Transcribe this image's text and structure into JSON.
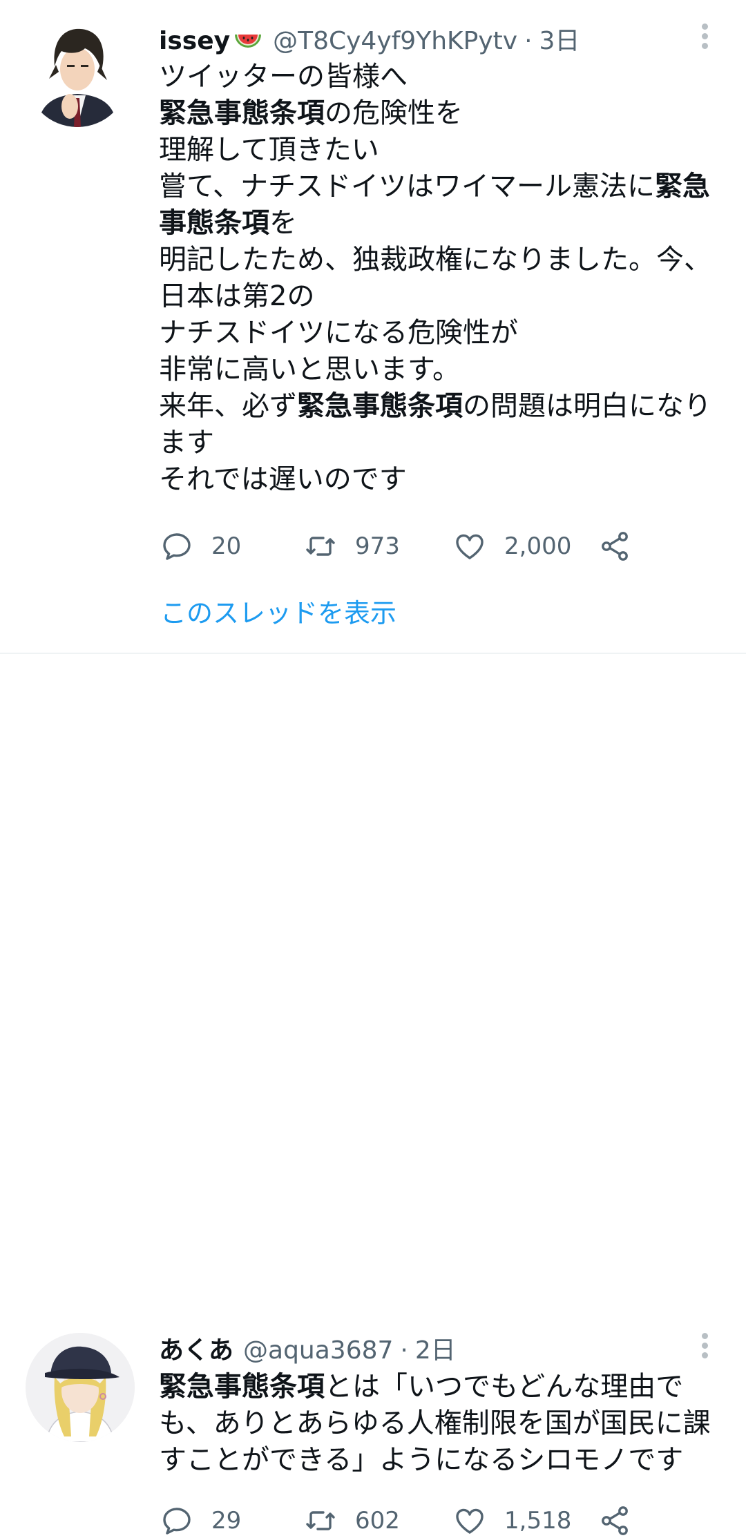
{
  "tweets": [
    {
      "display_name": "issey",
      "badge_icon": "watermelon-emoji",
      "handle": "@T8Cy4yf9YhKPytv",
      "separator": "·",
      "time": "3日",
      "lines": [
        [
          {
            "text": "ツイッターの皆様へ",
            "bold": false
          }
        ],
        [
          {
            "text": "緊急事態条項",
            "bold": true
          },
          {
            "text": "の危険性を",
            "bold": false
          }
        ],
        [
          {
            "text": "理解して頂きたい",
            "bold": false
          }
        ],
        [
          {
            "text": "嘗て、ナチスドイツはワイマール憲法に",
            "bold": false
          },
          {
            "text": "緊急",
            "bold": true
          }
        ],
        [
          {
            "text": "事態条項",
            "bold": true
          },
          {
            "text": "を",
            "bold": false
          }
        ],
        [
          {
            "text": "明記したため、独裁政権になりました。今、",
            "bold": false
          }
        ],
        [
          {
            "text": "日本は第2の",
            "bold": false
          }
        ],
        [
          {
            "text": "ナチスドイツになる危険性が",
            "bold": false
          }
        ],
        [
          {
            "text": "非常に高いと思います。",
            "bold": false
          }
        ],
        [
          {
            "text": "来年、必ず",
            "bold": false
          },
          {
            "text": "緊急事態条項",
            "bold": true
          },
          {
            "text": "の問題は明白になり",
            "bold": false
          }
        ],
        [
          {
            "text": "ます",
            "bold": false
          }
        ],
        [
          {
            "text": "それでは遅いのです",
            "bold": false
          }
        ]
      ],
      "replies": "20",
      "retweets": "973",
      "likes": "2,000",
      "thread_link": "このスレッドを表示"
    },
    {
      "display_name": "あくあ",
      "handle": "@aqua3687",
      "separator": "·",
      "time": "2日",
      "lines": [
        [
          {
            "text": "緊急事態条項",
            "bold": true
          },
          {
            "text": "とは「いつでもどんな理由で",
            "bold": false
          }
        ],
        [
          {
            "text": "も、ありとあらゆる人権制限を国が国民に課",
            "bold": false
          }
        ],
        [
          {
            "text": "すことができる」ようになるシロモノです",
            "bold": false
          }
        ]
      ],
      "replies": "29",
      "retweets": "602",
      "likes": "1,518"
    }
  ],
  "colors": {
    "text": "#0f1419",
    "secondary": "#536471",
    "link": "#1d9bf0",
    "divider": "#eff3f4"
  },
  "icons": [
    "reply-icon",
    "retweet-icon",
    "like-icon",
    "share-icon",
    "more-icon"
  ]
}
